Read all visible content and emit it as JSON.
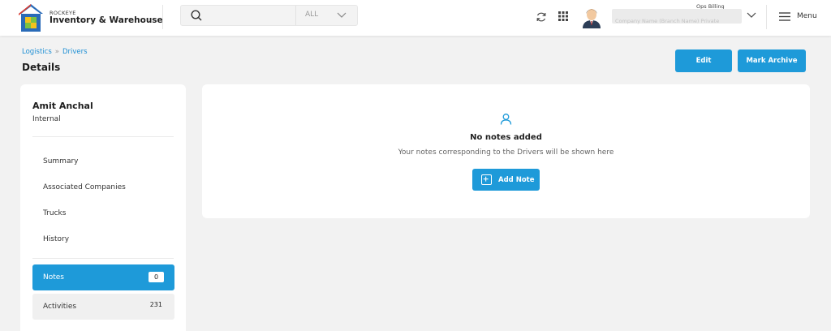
{
  "header": {
    "brand_small": "ROCKEYE",
    "brand_name": "Inventory & Warehouse",
    "search_placeholder": "",
    "search_filter": "ALL",
    "user_name": "Ops Billing",
    "user_company": "Company Name (Branch Name) Private",
    "menu_label": "Menu"
  },
  "page": {
    "breadcrumb": [
      "Logistics",
      "Drivers"
    ],
    "title": "Details",
    "buttons": {
      "edit": "Edit",
      "archive": "Mark Archive"
    }
  },
  "sidebar": {
    "name": "Amit Anchal",
    "type": "Internal",
    "items": [
      "Summary",
      "Associated Companies",
      "Trucks",
      "History"
    ],
    "notes": {
      "label": "Notes",
      "count": "0"
    },
    "activities": {
      "label": "Activities",
      "count": "231"
    }
  },
  "notes_panel": {
    "title": "No notes added",
    "subtitle": "Your notes corresponding to the Drivers will be shown here",
    "add_label": "Add Note"
  },
  "colors": {
    "accent": "#1e9ad9",
    "background": "#f2f2f2",
    "card": "#ffffff"
  }
}
